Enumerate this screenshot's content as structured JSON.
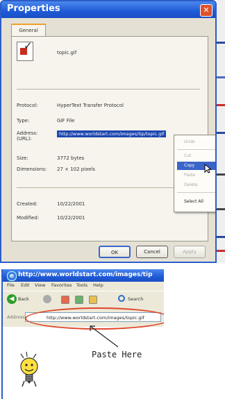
{
  "dialog": {
    "title": "Properties",
    "close_glyph": "✕",
    "tab_general": "General",
    "filename": "topic.gif",
    "rows": [
      {
        "label": "Protocol:",
        "value": "HyperText Transfer Protocol"
      },
      {
        "label": "Type:",
        "value": "GIF File"
      },
      {
        "label": "Address: (URL):",
        "value": "http://www.worldstart.com/images/tip/topic.gif"
      },
      {
        "label": "Size:",
        "value": "3772 bytes"
      },
      {
        "label": "Dimensions:",
        "value": "27 × 102 pixels"
      },
      {
        "label": "Created:",
        "value": "10/22/2001"
      },
      {
        "label": "Modified:",
        "value": "10/22/2001"
      }
    ],
    "context_menu": [
      "Undo",
      "Cut",
      "Copy",
      "Paste",
      "Delete",
      "Select All"
    ],
    "buttons": {
      "ok": "OK",
      "cancel": "Cancel",
      "apply": "Apply"
    },
    "accent": "#2c5cc8",
    "highlight": "#3a64c8"
  },
  "browser": {
    "title": "http://www.worldstart.com/images/tip",
    "menu": [
      "File",
      "Edit",
      "View",
      "Favorites",
      "Tools",
      "Help"
    ],
    "back_label": "Back",
    "search_label": "Search",
    "address_label": "Address",
    "address_value": "http://www.worldstart.com/images/topic.gif",
    "paste_caption": "Paste Here",
    "annotation_color": "#e0452a"
  }
}
